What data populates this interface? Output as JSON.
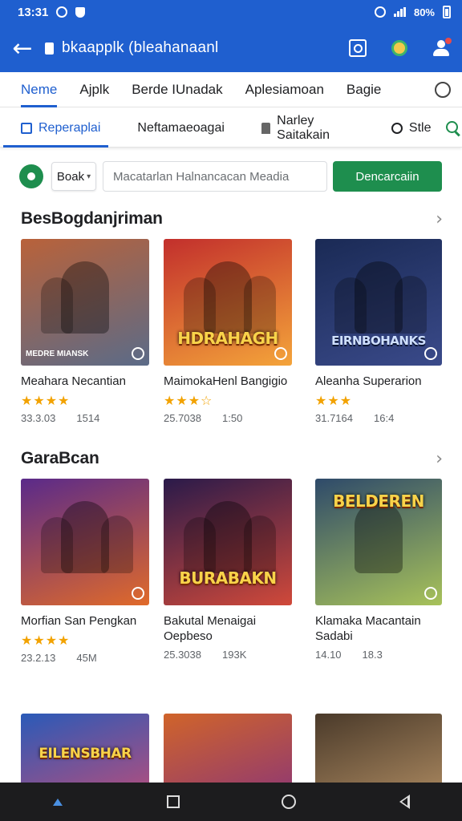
{
  "status_bar": {
    "time": "13:31",
    "battery": "80%"
  },
  "app_bar": {
    "title": "bkaapplk (bleahanaanl"
  },
  "tabs_primary": [
    "Neme",
    "Ajplk",
    "Berde IUnadak",
    "Aplesiamoan",
    "Bagie"
  ],
  "tabs_secondary": {
    "active": "Reperaplai",
    "items": [
      "Neftamaeoagai",
      "Narley Saitakain"
    ],
    "style_label": "Stle"
  },
  "search": {
    "scope": "Boak",
    "placeholder": "Macatarlan Halnancacan Meadia",
    "button": "Dencarcaiin"
  },
  "sections": [
    {
      "title": "BesBogdanjriman",
      "cards": [
        {
          "title": "Meahara Necantian",
          "banner": "MEDRE MIANSK",
          "rating": 4,
          "stars": "★★★★",
          "meta_a": "33.3.03",
          "meta_b": "1514",
          "colors": [
            "#b9623a",
            "#5b6b88"
          ]
        },
        {
          "title": "MaimokaHenl Bangigio",
          "banner": "HDRAHAGH",
          "rating": 3.5,
          "stars": "★★★☆",
          "meta_a": "25.7038",
          "meta_b": "1:50",
          "colors": [
            "#c22f2c",
            "#f4a43a"
          ]
        },
        {
          "title": "Aleanha Superarion",
          "banner": "EIRNBOHANKS",
          "rating": 3,
          "stars": "★★★",
          "meta_a": "31.7164",
          "meta_b": "16:4",
          "colors": [
            "#1a2a55",
            "#3a4a8a"
          ]
        }
      ]
    },
    {
      "title": "GaraBcan",
      "cards": [
        {
          "title": "Morfian San Pengkan",
          "banner": "",
          "rating": 3.5,
          "stars": "★★★★",
          "meta_a": "23.2.13",
          "meta_b": "45M",
          "colors": [
            "#5a2a8a",
            "#e06a2a"
          ]
        },
        {
          "title": "Bakutal Menaigai",
          "sub": "Oepbeso",
          "banner": "BURABAKN",
          "rating": 0,
          "stars": "",
          "meta_a": "25.3038",
          "meta_b": "193K",
          "colors": [
            "#2a1a4a",
            "#d0493a"
          ]
        },
        {
          "title": "Klamaka Macantain",
          "sub": "Sadabi",
          "banner": "BELDEREN",
          "rating": 0,
          "stars": "",
          "meta_a": "14.10",
          "meta_b": "18.3",
          "colors": [
            "#2e4a6a",
            "#a8c25a"
          ]
        }
      ]
    },
    {
      "title": "",
      "cards": [
        {
          "title": "",
          "banner": "EILENSBHAR",
          "colors": [
            "#2a5ab8",
            "#e04a6a"
          ]
        },
        {
          "title": "",
          "banner": "",
          "colors": [
            "#d0642a",
            "#7a2a8a"
          ]
        },
        {
          "title": "",
          "banner": "",
          "colors": [
            "#4a3a2a",
            "#c8a070"
          ]
        }
      ]
    }
  ]
}
